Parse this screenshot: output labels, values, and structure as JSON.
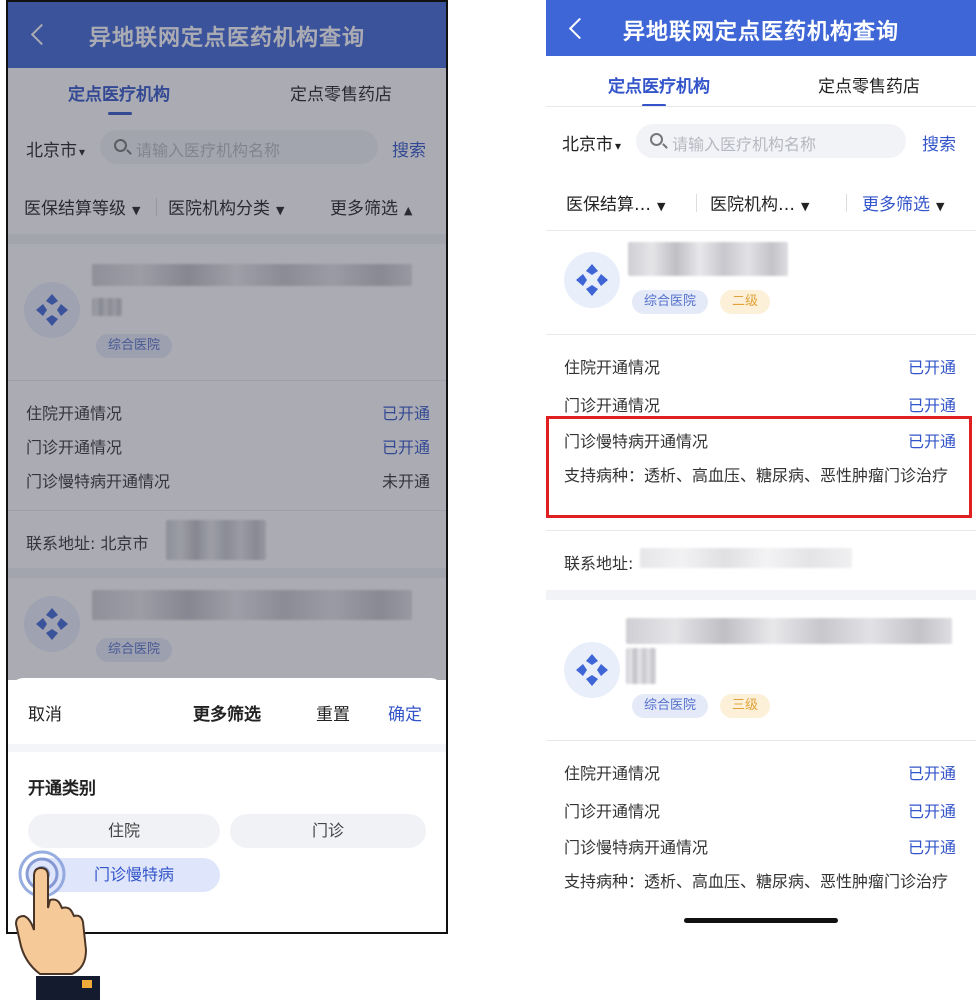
{
  "left": {
    "header": {
      "title": "异地联网定点医药机构查询"
    },
    "tabs": [
      "定点医疗机构",
      "定点零售药店"
    ],
    "search": {
      "city": "北京市",
      "placeholder": "请输入医疗机构名称",
      "button": "搜索"
    },
    "filters": [
      "医保结算等级",
      "医院机构分类",
      "更多筛选"
    ],
    "cards": [
      {
        "tags": [
          "综合医院"
        ],
        "rows": [
          {
            "label": "住院开通情况",
            "value": "已开通",
            "status": "on"
          },
          {
            "label": "门诊开通情况",
            "value": "已开通",
            "status": "on"
          },
          {
            "label": "门诊慢特病开通情况",
            "value": "未开通",
            "status": "off"
          }
        ],
        "address_label": "联系地址:",
        "address_prefix": "北京市"
      },
      {
        "tags": [
          "综合医院"
        ]
      }
    ],
    "sheet": {
      "cancel": "取消",
      "title": "更多筛选",
      "reset": "重置",
      "confirm": "确定",
      "section": "开通类别",
      "options": [
        "住院",
        "门诊",
        "门诊慢特病"
      ],
      "selected": "门诊慢特病"
    }
  },
  "right": {
    "header": {
      "title": "异地联网定点医药机构查询"
    },
    "tabs": [
      "定点医疗机构",
      "定点零售药店"
    ],
    "search": {
      "city": "北京市",
      "placeholder": "请输入医疗机构名称",
      "button": "搜索"
    },
    "filters": [
      "医保结算…",
      "医院机构…",
      "更多筛选"
    ],
    "cards": [
      {
        "tags": [
          "综合医院",
          "二级"
        ],
        "rows": [
          {
            "label": "住院开通情况",
            "value": "已开通"
          },
          {
            "label": "门诊开通情况",
            "value": "已开通"
          },
          {
            "label": "门诊慢特病开通情况",
            "value": "已开通"
          }
        ],
        "diseases": "支持病种：透析、高血压、糖尿病、恶性肿瘤门诊治疗",
        "address_label": "联系地址:"
      },
      {
        "tags": [
          "综合医院",
          "三级"
        ],
        "rows": [
          {
            "label": "住院开通情况",
            "value": "已开通"
          },
          {
            "label": "门诊开通情况",
            "value": "已开通"
          },
          {
            "label": "门诊慢特病开通情况",
            "value": "已开通"
          }
        ],
        "diseases": "支持病种：透析、高血压、糖尿病、恶性肿瘤门诊治疗"
      }
    ]
  },
  "colors": {
    "brand": "#3f66d6",
    "link": "#3355c9",
    "highlight": "#e02020"
  },
  "icons": [
    "chevron-left-icon",
    "search-icon",
    "hospital-logo-icon",
    "tap-hand-icon"
  ]
}
